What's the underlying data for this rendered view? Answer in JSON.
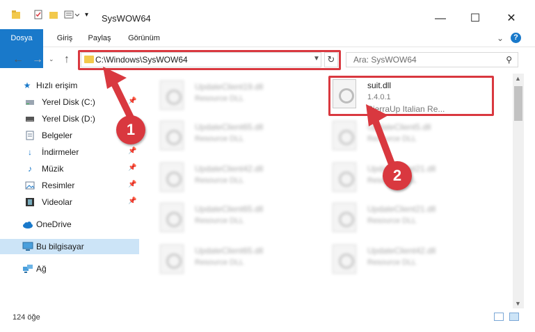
{
  "window": {
    "title": "SysWOW64",
    "minimize": "—",
    "maximize": "☐",
    "close": "✕"
  },
  "ribbon": {
    "tabs": [
      "Dosya",
      "Giriş",
      "Paylaş",
      "Görünüm"
    ],
    "expand_icon": "chevron-down-icon",
    "help_icon": "help-icon"
  },
  "address": {
    "path": "C:\\Windows\\SysWOW64",
    "search_placeholder": "Ara: SysWOW64"
  },
  "sidebar": {
    "quick_access": "Hızlı erişim",
    "items": [
      {
        "label": "Yerel Disk (C:)",
        "pinned": true
      },
      {
        "label": "Yerel Disk (D:)",
        "pinned": false
      },
      {
        "label": "Belgeler",
        "pinned": false
      },
      {
        "label": "İndirmeler",
        "pinned": true
      },
      {
        "label": "Müzik",
        "pinned": true
      },
      {
        "label": "Resimler",
        "pinned": true
      },
      {
        "label": "Videolar",
        "pinned": true
      }
    ],
    "onedrive": "OneDrive",
    "this_pc": "Bu bilgisayar",
    "network": "Ağ"
  },
  "files": {
    "highlighted": {
      "name": "suit.dll",
      "version": "1.4.0.1",
      "description": "SierraUp Italian Re..."
    },
    "left_column": [
      {
        "name": "UpdateClient19.dll",
        "desc": "Resource DLL"
      },
      {
        "name": "UpdateClient65.dll",
        "desc": "Resource DLL"
      },
      {
        "name": "UpdateClient42.dll",
        "desc": "Resource DLL"
      },
      {
        "name": "UpdateClient65.dll",
        "desc": "Resource DLL"
      },
      {
        "name": "UpdateClient65.dll",
        "desc": "Resource DLL"
      }
    ],
    "right_column": [
      {
        "name": "UpdateClient5.dll",
        "desc": "Resource DLL"
      },
      {
        "name": "UpdateClient21.dll",
        "desc": "Resource DLL"
      },
      {
        "name": "UpdateClient21.dll",
        "desc": "Resource DLL"
      },
      {
        "name": "UpdateClient42.dll",
        "desc": "Resource DLL"
      }
    ]
  },
  "status": {
    "item_count": "124 öğe"
  },
  "annotations": {
    "step1": "1",
    "step2": "2",
    "color": "#d9383f"
  }
}
